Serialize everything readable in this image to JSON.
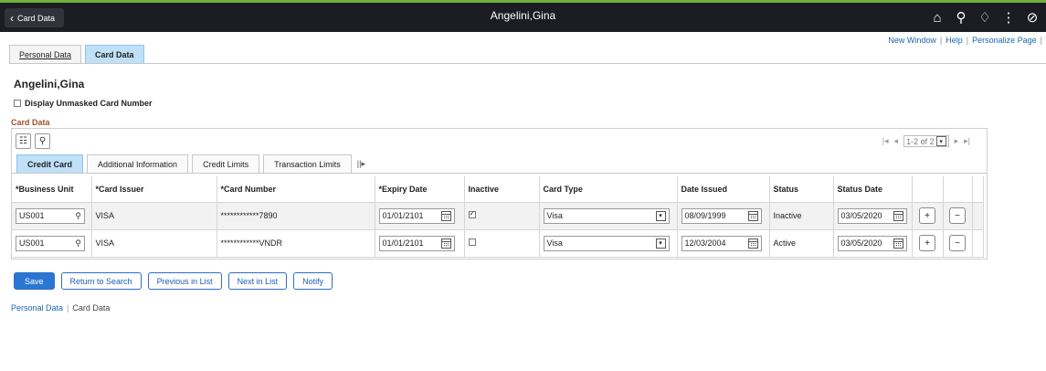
{
  "header": {
    "back_label": "Card Data",
    "title": "Angelini,Gina",
    "icons": [
      "home-icon",
      "search-icon",
      "notifications-icon",
      "actions-menu-icon",
      "navbar-icon"
    ]
  },
  "top_links": [
    "New Window",
    "Help",
    "Personalize Page"
  ],
  "page_tabs": [
    {
      "label": "Personal Data",
      "active": false
    },
    {
      "label": "Card Data",
      "active": true
    }
  ],
  "person_name": "Angelini,Gina",
  "display_unmasked_label": "Display Unmasked Card Number",
  "section_title": "Card Data",
  "pager": {
    "text": "1-2 of 2"
  },
  "sub_tabs": [
    {
      "label": "Credit Card",
      "active": true
    },
    {
      "label": "Additional Information",
      "active": false
    },
    {
      "label": "Credit Limits",
      "active": false
    },
    {
      "label": "Transaction Limits",
      "active": false
    }
  ],
  "columns": [
    "*Business Unit",
    "*Card Issuer",
    "*Card Number",
    "*Expiry Date",
    "Inactive",
    "Card Type",
    "Date Issued",
    "Status",
    "Status Date"
  ],
  "rows": [
    {
      "business_unit": "US001",
      "card_issuer": "VISA",
      "card_number": "************7890",
      "expiry_date": "01/01/2101",
      "inactive": true,
      "card_type": "Visa",
      "date_issued": "08/09/1999",
      "status": "Inactive",
      "status_date": "03/05/2020"
    },
    {
      "business_unit": "US001",
      "card_issuer": "VISA",
      "card_number": "************VNDR",
      "expiry_date": "01/01/2101",
      "inactive": false,
      "card_type": "Visa",
      "date_issued": "12/03/2004",
      "status": "Active",
      "status_date": "03/05/2020"
    }
  ],
  "buttons": {
    "save": "Save",
    "return_to_search": "Return to Search",
    "previous_in_list": "Previous in List",
    "next_in_list": "Next in List",
    "notify": "Notify"
  },
  "breadcrumbs": {
    "link": "Personal Data",
    "current": "Card Data"
  },
  "colors": {
    "header_bg": "#1b1d22",
    "accent_bar": "#6fb03f",
    "active_tab": "#bfe0f7",
    "primary_button": "#2a77d3",
    "section_title": "#a0522d",
    "link": "#1a66b3"
  }
}
